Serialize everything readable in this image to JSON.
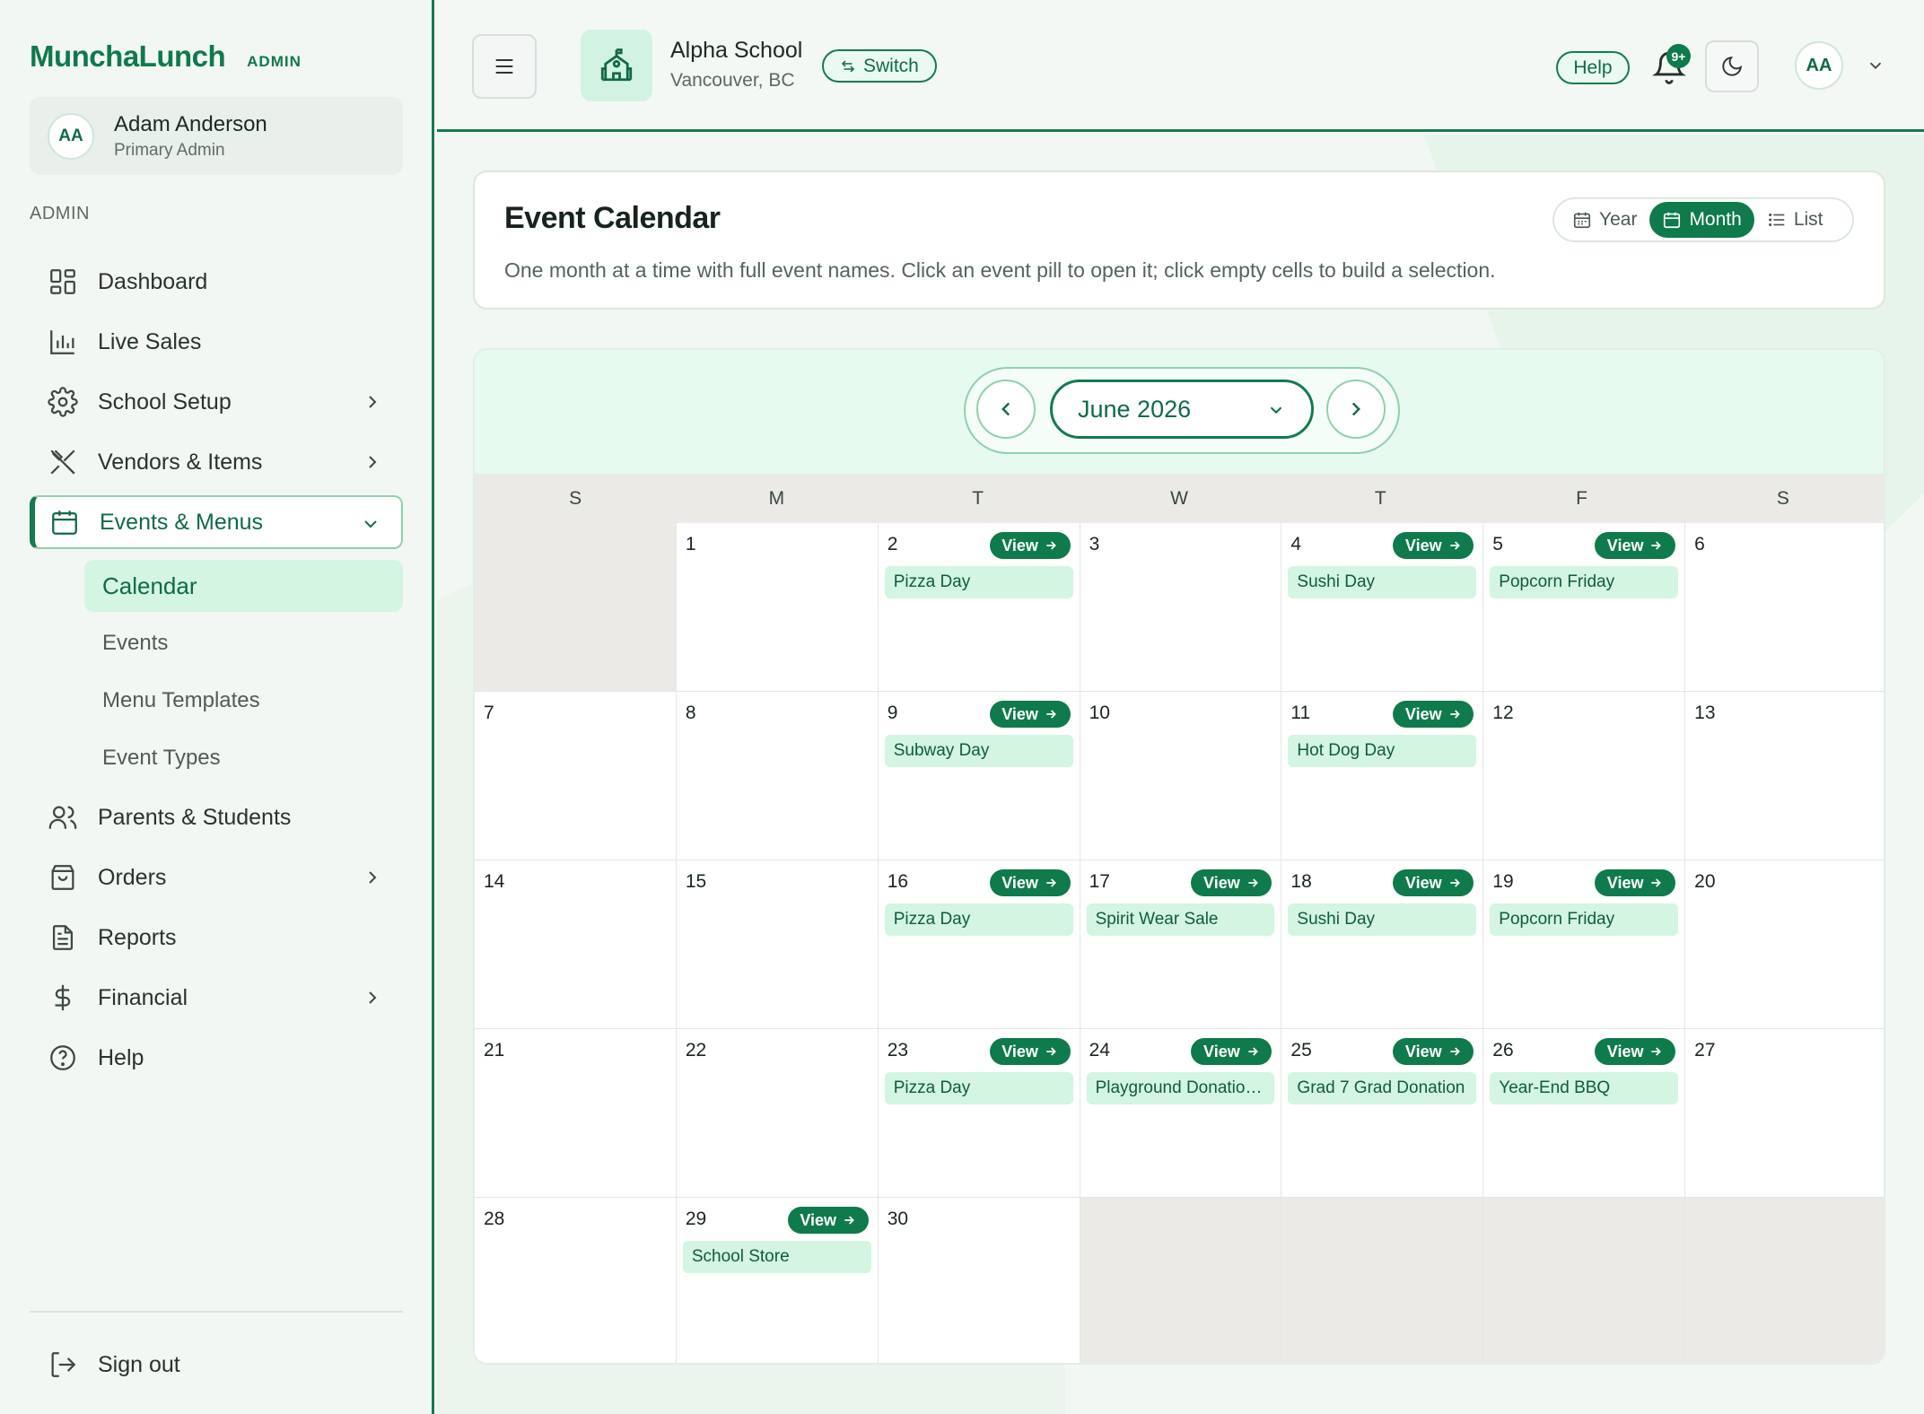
{
  "brand": {
    "name": "MunchaLunch",
    "badge": "ADMIN"
  },
  "user": {
    "initials": "AA",
    "name": "Adam Anderson",
    "role": "Primary Admin"
  },
  "sidebar": {
    "section_label": "ADMIN",
    "items": [
      {
        "label": "Dashboard",
        "icon": "dashboard-icon"
      },
      {
        "label": "Live Sales",
        "icon": "bar-chart-icon"
      },
      {
        "label": "School Setup",
        "icon": "gear-icon",
        "has_chevron": true
      },
      {
        "label": "Vendors & Items",
        "icon": "utensils-icon",
        "has_chevron": true
      },
      {
        "label": "Events & Menus",
        "icon": "calendar-icon",
        "expanded": true,
        "active": true
      },
      {
        "label": "Parents & Students",
        "icon": "users-icon"
      },
      {
        "label": "Orders",
        "icon": "shopping-bag-icon",
        "has_chevron": true
      },
      {
        "label": "Reports",
        "icon": "document-icon"
      },
      {
        "label": "Financial",
        "icon": "dollar-icon",
        "has_chevron": true
      },
      {
        "label": "Help",
        "icon": "help-circle-icon"
      }
    ],
    "sub_items": [
      {
        "label": "Calendar",
        "active": true
      },
      {
        "label": "Events"
      },
      {
        "label": "Menu Templates"
      },
      {
        "label": "Event Types"
      }
    ],
    "sign_out": "Sign out"
  },
  "topbar": {
    "school_name": "Alpha School",
    "school_location": "Vancouver, BC",
    "switch_label": "Switch",
    "help_label": "Help",
    "notification_count": "9+",
    "avatar_initials": "AA"
  },
  "page": {
    "title": "Event Calendar",
    "description": "One month at a time with full event names. Click an event pill to open it; click empty cells to build a selection.",
    "views": [
      "Year",
      "Month",
      "List"
    ],
    "active_view": "Month"
  },
  "calendar": {
    "month_label": "June 2026",
    "weekdays": [
      "S",
      "M",
      "T",
      "W",
      "T",
      "F",
      "S"
    ],
    "view_label": "View",
    "weeks": [
      [
        null,
        {
          "day": "1"
        },
        {
          "day": "2",
          "event": "Pizza Day"
        },
        {
          "day": "3"
        },
        {
          "day": "4",
          "event": "Sushi Day"
        },
        {
          "day": "5",
          "event": "Popcorn Friday"
        },
        {
          "day": "6"
        }
      ],
      [
        {
          "day": "7"
        },
        {
          "day": "8"
        },
        {
          "day": "9",
          "event": "Subway Day"
        },
        {
          "day": "10"
        },
        {
          "day": "11",
          "event": "Hot Dog Day"
        },
        {
          "day": "12"
        },
        {
          "day": "13"
        }
      ],
      [
        {
          "day": "14"
        },
        {
          "day": "15"
        },
        {
          "day": "16",
          "event": "Pizza Day"
        },
        {
          "day": "17",
          "event": "Spirit Wear Sale"
        },
        {
          "day": "18",
          "event": "Sushi Day"
        },
        {
          "day": "19",
          "event": "Popcorn Friday"
        },
        {
          "day": "20"
        }
      ],
      [
        {
          "day": "21"
        },
        {
          "day": "22"
        },
        {
          "day": "23",
          "event": "Pizza Day"
        },
        {
          "day": "24",
          "event": "Playground Donatio…"
        },
        {
          "day": "25",
          "event": "Grad 7 Grad Donation"
        },
        {
          "day": "26",
          "event": "Year-End BBQ"
        },
        {
          "day": "27"
        }
      ],
      [
        {
          "day": "28"
        },
        {
          "day": "29",
          "event": "School Store"
        },
        {
          "day": "30"
        },
        null,
        null,
        null,
        null
      ]
    ]
  },
  "colors": {
    "accent": "#0f7a4b",
    "event_bg": "#d3f5e2",
    "header_bg": "#e7faef"
  }
}
